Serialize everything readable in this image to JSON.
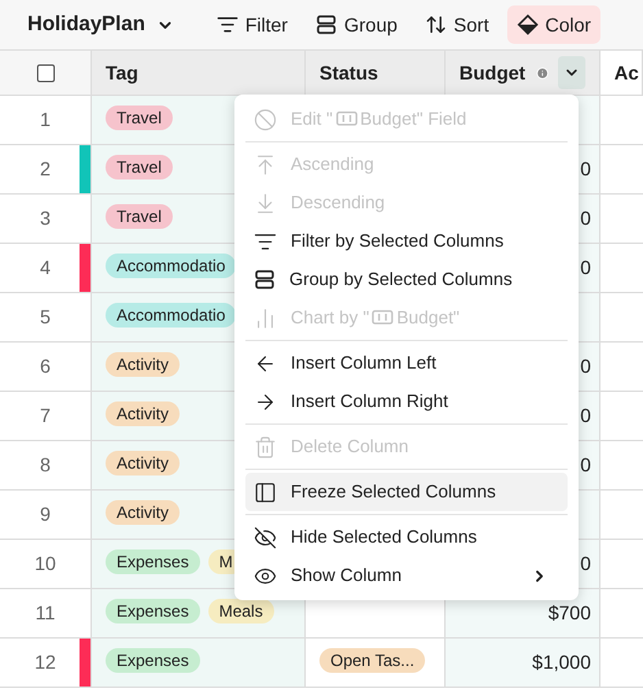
{
  "toolbar": {
    "view": "HolidayPlan",
    "actions": [
      {
        "label": "Filter",
        "selected": false
      },
      {
        "label": "Group",
        "selected": false
      },
      {
        "label": "Sort",
        "selected": false
      },
      {
        "label": "Color",
        "selected": true
      }
    ]
  },
  "table": {
    "select_all": {
      "checked": false
    },
    "columns": [
      {
        "title": "Tag",
        "selected": true
      },
      {
        "title": "Status",
        "selected": false
      },
      {
        "title": "Budget",
        "selected": true,
        "info": true,
        "menu_open": true
      },
      {
        "title": "Ac",
        "selected": false
      }
    ],
    "rows": [
      {
        "number": "1",
        "tags": [
          {
            "label": "Travel",
            "color": "#f6c3cc"
          }
        ],
        "budget": ""
      },
      {
        "number": "2",
        "color": "#11c4b8",
        "tags": [
          {
            "label": "Travel",
            "color": "#f6c3cc"
          }
        ],
        "budget": "0"
      },
      {
        "number": "3",
        "tags": [
          {
            "label": "Travel",
            "color": "#f6c3cc"
          }
        ],
        "budget": "0"
      },
      {
        "number": "4",
        "color": "#fd2c56",
        "tags": [
          {
            "label": "Accommodatio",
            "color": "#b6ebe6"
          }
        ],
        "budget": "0"
      },
      {
        "number": "5",
        "tags": [
          {
            "label": "Accommodatio",
            "color": "#b6ebe6"
          }
        ],
        "budget": ""
      },
      {
        "number": "6",
        "tags": [
          {
            "label": "Activity",
            "color": "#f7dcbc"
          }
        ],
        "budget": "0"
      },
      {
        "number": "7",
        "tags": [
          {
            "label": "Activity",
            "color": "#f7dcbc"
          }
        ],
        "budget": "0"
      },
      {
        "number": "8",
        "tags": [
          {
            "label": "Activity",
            "color": "#f7dcbc"
          }
        ],
        "budget": "0"
      },
      {
        "number": "9",
        "tags": [
          {
            "label": "Activity",
            "color": "#f7dcbc"
          }
        ],
        "budget": ""
      },
      {
        "number": "10",
        "tags": [
          {
            "label": "Expenses",
            "color": "#c6edd0"
          },
          {
            "label": "M",
            "color": "#f6ecc0"
          }
        ],
        "budget": "0"
      },
      {
        "number": "11",
        "tags": [
          {
            "label": "Expenses",
            "color": "#c6edd0"
          },
          {
            "label": "Meals",
            "color": "#f6ecc0"
          }
        ],
        "budget": "$700"
      },
      {
        "number": "12",
        "color": "#fd2c56",
        "tags": [
          {
            "label": "Expenses",
            "color": "#c6edd0"
          }
        ],
        "status": {
          "label": "Open Tas...",
          "color": "#f7dcbc"
        },
        "budget": "$1,000"
      }
    ]
  },
  "column_menu": {
    "groups": [
      [
        {
          "label": [
            "Edit \"",
            "Budget\" Field"
          ],
          "disabled": true,
          "highlighted": false
        }
      ],
      [
        {
          "label": [
            "Ascending"
          ],
          "disabled": true,
          "highlighted": false
        },
        {
          "label": [
            "Descending"
          ],
          "disabled": true,
          "highlighted": false
        },
        {
          "label": [
            "Filter by Selected Columns"
          ],
          "disabled": false,
          "highlighted": false
        },
        {
          "label": [
            "Group by Selected Columns"
          ],
          "disabled": false,
          "highlighted": false
        },
        {
          "label": [
            "Chart by \"",
            "Budget\""
          ],
          "disabled": true,
          "highlighted": false
        }
      ],
      [
        {
          "label": [
            "Insert Column Left"
          ],
          "disabled": false,
          "highlighted": false
        },
        {
          "label": [
            "Insert Column Right"
          ],
          "disabled": false,
          "highlighted": false
        }
      ],
      [
        {
          "label": [
            "Delete Column"
          ],
          "disabled": true,
          "highlighted": false
        }
      ],
      [
        {
          "label": [
            "Freeze Selected Columns"
          ],
          "disabled": false,
          "highlighted": true
        }
      ],
      [
        {
          "label": [
            "Hide Selected Columns"
          ],
          "disabled": false,
          "highlighted": false
        },
        {
          "label": [
            "Show Column"
          ],
          "disabled": false,
          "highlighted": false,
          "submenu": true
        }
      ]
    ]
  }
}
